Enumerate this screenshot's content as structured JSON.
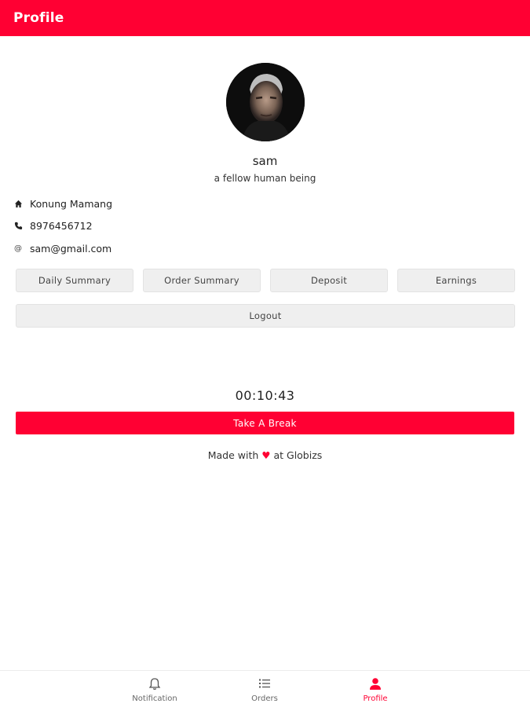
{
  "app_bar": {
    "title": "Profile"
  },
  "profile": {
    "name": "sam",
    "bio": "a fellow human being",
    "address": "Konung Mamang",
    "phone": "8976456712",
    "email": "sam@gmail.com"
  },
  "actions": {
    "daily_summary": "Daily Summary",
    "order_summary": "Order Summary",
    "deposit": "Deposit",
    "earnings": "Earnings",
    "logout": "Logout"
  },
  "timer": {
    "value": "00:10:43"
  },
  "break_button": {
    "label": "Take A Break"
  },
  "footer": {
    "prefix": "Made with",
    "heart": "♥",
    "suffix": "at Globizs"
  },
  "bottom_nav": {
    "items": [
      {
        "label": "Notification",
        "icon": "bell-icon",
        "active": false
      },
      {
        "label": "Orders",
        "icon": "list-icon",
        "active": false
      },
      {
        "label": "Profile",
        "icon": "person-icon",
        "active": true
      }
    ]
  },
  "colors": {
    "accent": "#ff0033",
    "button_bg": "#efefef"
  }
}
